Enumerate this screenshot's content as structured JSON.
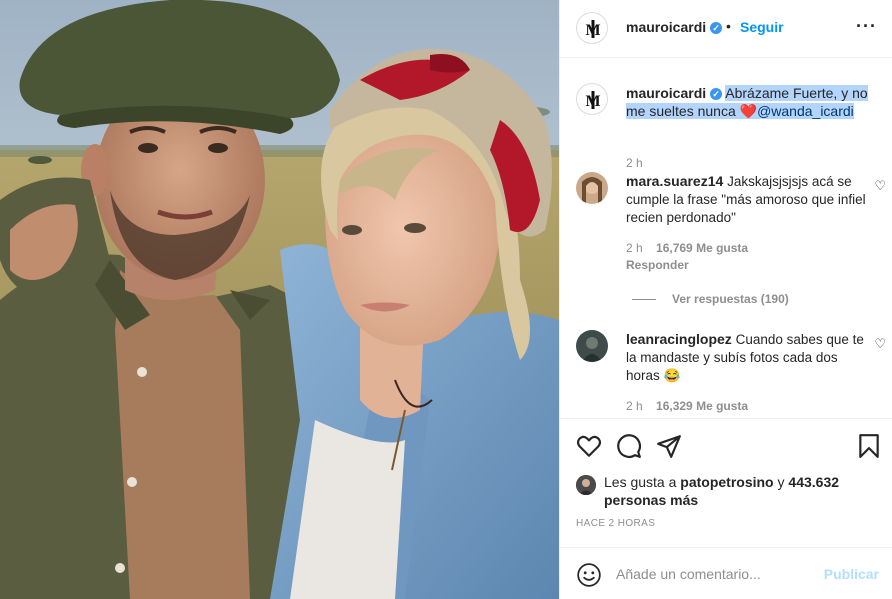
{
  "post": {
    "author": "mauroicardi",
    "verified_badge": "verified-icon",
    "separator": "•",
    "follow_label": "Seguir",
    "more_label": "•••"
  },
  "caption": {
    "author": "mauroicardi",
    "text": "Abrázame Fuerte, y no me sueltes nunca ",
    "heart": "❤️",
    "mention": "@wanda_icardi",
    "time": "2 h"
  },
  "comments": [
    {
      "author": "mara.suarez14",
      "text": "Jakskajsjsjsjs acá se cumple la frase \"más amoroso que infiel recien perdonado\"",
      "time": "2 h",
      "likes": "16,769 Me gusta",
      "reply_label": "Responder",
      "view_replies": "Ver respuestas (190)"
    },
    {
      "author": "leanracinglopez",
      "text": "Cuando sabes que te la mandaste y subís fotos cada dos horas ",
      "emoji": "😂",
      "time": "2 h",
      "likes": "16,329 Me gusta"
    }
  ],
  "likes": {
    "prefix": "Les gusta a ",
    "user": "patopetrosino",
    "conj": " y",
    "count": "443.632 personas más"
  },
  "posted_ago": "HACE 2 HORAS",
  "add_comment": {
    "placeholder": "Añade un comentario...",
    "publish_label": "Publicar"
  },
  "icons": {
    "like": "heart-outline-icon",
    "comment": "comment-bubble-icon",
    "share": "paper-plane-icon",
    "save": "bookmark-icon",
    "emoji": "smiley-icon"
  },
  "colors": {
    "accent": "#0095f6",
    "publish_disabled": "#b2dffc",
    "text": "#262626",
    "muted": "#8e8e8e",
    "verified": "#3897f0",
    "selection": "#b3d4fc"
  }
}
